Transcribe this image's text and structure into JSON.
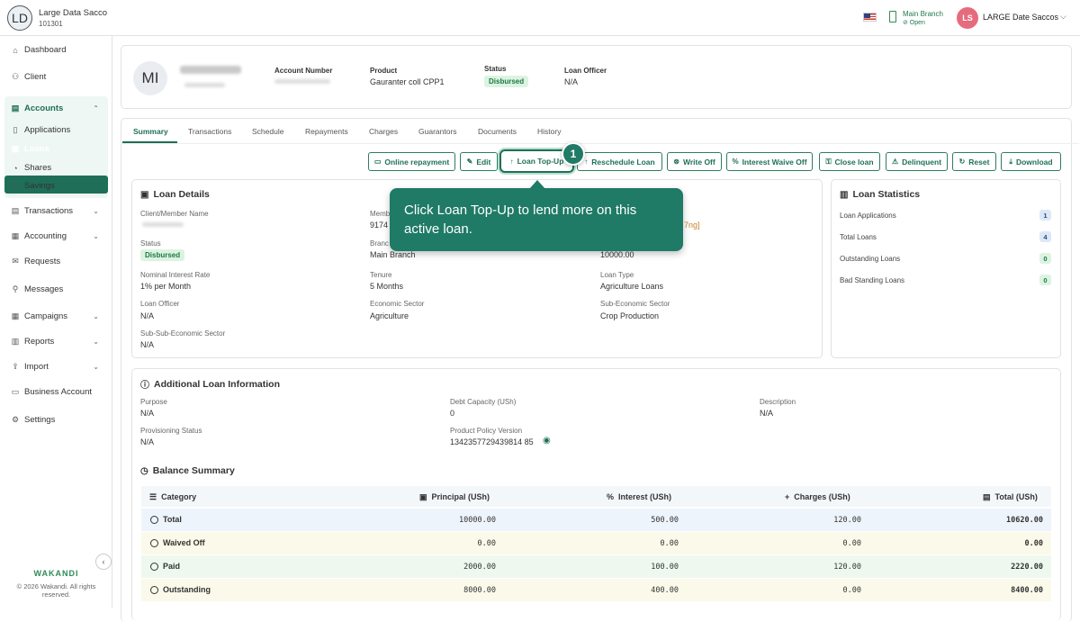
{
  "org": {
    "logo_initials": "LD",
    "name": "Large Data Sacco",
    "id": "101301"
  },
  "topbar": {
    "branch_name": "Main Branch",
    "branch_status": "⊘ Open",
    "avatar_initials": "LS",
    "user_name": "LARGE Date Saccos"
  },
  "sidebar": {
    "items": [
      {
        "label": "Dashboard",
        "icon": "dashboard-icon"
      },
      {
        "label": "Client",
        "icon": "users-icon"
      },
      {
        "label": "Accounts",
        "icon": "accounts-icon"
      },
      {
        "label": "Applications",
        "icon": "document-icon"
      },
      {
        "label": "Loans",
        "icon": "loan-icon"
      },
      {
        "label": "Shares",
        "icon": "shares-icon"
      },
      {
        "label": "Savings",
        "icon": "savings-icon"
      },
      {
        "label": "Transactions",
        "icon": "transactions-icon"
      },
      {
        "label": "Accounting",
        "icon": "accounting-icon"
      },
      {
        "label": "Requests",
        "icon": "requests-icon"
      },
      {
        "label": "Messages",
        "icon": "messages-icon"
      },
      {
        "label": "Campaigns",
        "icon": "campaigns-icon"
      },
      {
        "label": "Reports",
        "icon": "reports-icon"
      },
      {
        "label": "Import",
        "icon": "import-icon"
      },
      {
        "label": "Business Account",
        "icon": "business-icon"
      },
      {
        "label": "Settings",
        "icon": "settings-icon"
      }
    ],
    "brand": "WAKANDI",
    "copyright": "© 2026 Wakandi. All rights reserved."
  },
  "header": {
    "avatar_initials": "MI",
    "account_number_label": "Account Number",
    "product_label": "Product",
    "product_value": "Gauranter coll CPP1",
    "status_label": "Status",
    "status_value": "Disbursed",
    "loan_officer_label": "Loan Officer",
    "loan_officer_value": "N/A"
  },
  "tabs": [
    "Summary",
    "Transactions",
    "Schedule",
    "Repayments",
    "Charges",
    "Guarantors",
    "Documents",
    "History"
  ],
  "actions": [
    {
      "label": "Online repayment",
      "icon": "card-icon"
    },
    {
      "label": "Edit",
      "icon": "edit-icon"
    },
    {
      "label": "Loan Top-Up",
      "icon": "arrow-up-icon"
    },
    {
      "label": "Reschedule Loan",
      "icon": "arrow-up-icon"
    },
    {
      "label": "Write Off",
      "icon": "cancel-icon"
    },
    {
      "label": "Interest Waive Off",
      "icon": "percent-icon"
    },
    {
      "label": "Close loan",
      "icon": "lock-icon"
    },
    {
      "label": "Delinquent",
      "icon": "warning-icon"
    },
    {
      "label": "Reset",
      "icon": "refresh-icon"
    },
    {
      "label": "Download",
      "icon": "download-icon"
    }
  ],
  "loan_details": {
    "title": "Loan Details",
    "client_member_name_label": "Client/Member Name",
    "member_label_partial": "Memb",
    "member_value_partial": "9174",
    "status_label": "Status",
    "status_value": "Disbursed",
    "branch_label_partial": "Branc",
    "branch_value": "Main Branch",
    "amount_value": "10000.00",
    "bracket_partial": "7ng]",
    "nominal_rate_label": "Nominal Interest Rate",
    "nominal_rate_value": "1% per Month",
    "tenure_label": "Tenure",
    "tenure_value": "5 Months",
    "loan_type_label": "Loan Type",
    "loan_type_value": "Agriculture Loans",
    "loan_officer_label": "Loan Officer",
    "loan_officer_value": "N/A",
    "economic_sector_label": "Economic Sector",
    "economic_sector_value": "Agriculture",
    "sub_economic_sector_label": "Sub-Economic Sector",
    "sub_economic_sector_value": "Crop Production",
    "sub_sub_sector_label": "Sub-Sub-Economic Sector",
    "sub_sub_sector_value": "N/A"
  },
  "loan_statistics": {
    "title": "Loan Statistics",
    "items": [
      {
        "label": "Loan Applications",
        "value": "1",
        "color": "#dde8f7"
      },
      {
        "label": "Total Loans",
        "value": "4",
        "color": "#dde8f7"
      },
      {
        "label": "Outstanding Loans",
        "value": "0",
        "color": "#dcf3e2"
      },
      {
        "label": "Bad Standing Loans",
        "value": "0",
        "color": "#dcf3e2"
      }
    ]
  },
  "tooltip": {
    "step": "1",
    "text": "Click Loan Top-Up to lend more on this active loan."
  },
  "additional_info": {
    "title": "Additional Loan Information",
    "purpose_label": "Purpose",
    "purpose_value": "N/A",
    "debt_capacity_label": "Debt Capacity (USh)",
    "debt_capacity_value": "0",
    "description_label": "Description",
    "description_value": "N/A",
    "provisioning_label": "Provisioning Status",
    "provisioning_value": "N/A",
    "policy_version_label": "Product Policy Version",
    "policy_version_value": "1342357729439814 85"
  },
  "balance_summary": {
    "title": "Balance Summary",
    "columns": [
      "Category",
      "Principal (USh)",
      "Interest (USh)",
      "Charges (USh)",
      "Total (USh)"
    ],
    "rows": [
      {
        "category": "Total",
        "principal": "10000.00",
        "interest": "500.00",
        "charges": "120.00",
        "total": "10620.00",
        "bg": "#eef4fb"
      },
      {
        "category": "Waived Off",
        "principal": "0.00",
        "interest": "0.00",
        "charges": "0.00",
        "total": "0.00",
        "bg": "#fbf9e9"
      },
      {
        "category": "Paid",
        "principal": "2000.00",
        "interest": "100.00",
        "charges": "120.00",
        "total": "2220.00",
        "bg": "#eef8ef"
      },
      {
        "category": "Outstanding",
        "principal": "8000.00",
        "interest": "400.00",
        "charges": "0.00",
        "total": "8400.00",
        "bg": "#fbf9e9"
      }
    ]
  }
}
